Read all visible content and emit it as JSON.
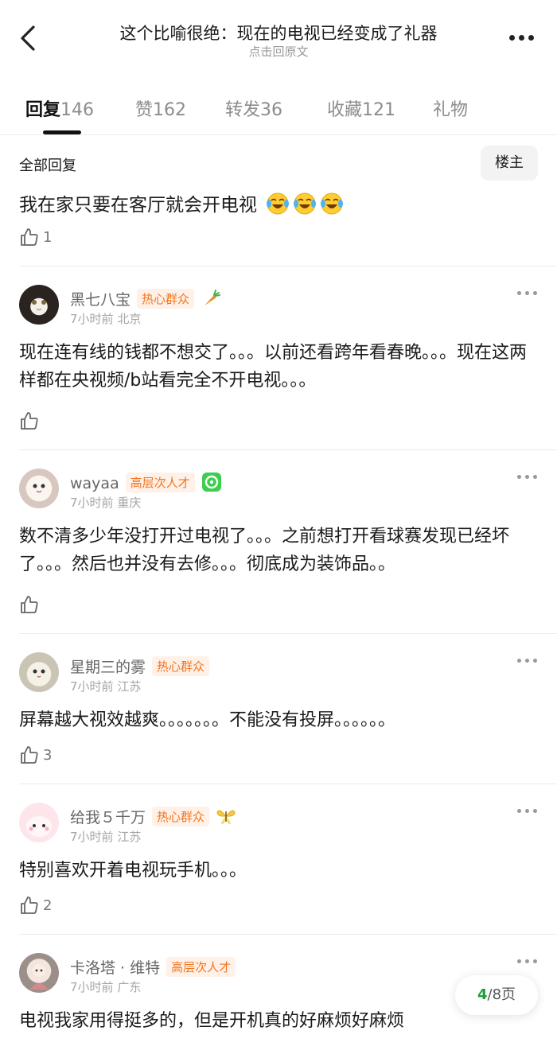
{
  "header": {
    "title": "这个比喻很绝：现在的电视已经变成了礼器",
    "subtitle": "点击回原文"
  },
  "tabs": [
    {
      "label": "回复",
      "count": "146"
    },
    {
      "label": "赞",
      "count": "162"
    },
    {
      "label": "转发",
      "count": "36"
    },
    {
      "label": "收藏",
      "count": "121"
    },
    {
      "label": "礼物",
      "count": ""
    }
  ],
  "post": {
    "section_label": "全部回复",
    "owner_button": "楼主",
    "text": "我在家只要在客厅就会开电视",
    "emoji_icons": [
      "laughing-tears-emoji",
      "laughing-tears-emoji",
      "laughing-tears-emoji"
    ],
    "likes": "1"
  },
  "comments": [
    {
      "user": "黑七八宝",
      "badge": "热心群众",
      "decoration": "carrot-icon",
      "time": "7小时前",
      "location": "北京",
      "text": "现在连有线的钱都不想交了。。。以前还看跨年看春晚。。。现在这两样都在央视频/b站看完全不开电视。。。",
      "likes": ""
    },
    {
      "user": "wayaa",
      "badge": "高层次人才",
      "decoration": "green-badge-icon",
      "time": "7小时前",
      "location": "重庆",
      "text": "数不清多少年没打开过电视了。。。之前想打开看球赛发现已经坏了。。。然后也并没有去修。。。彻底成为装饰品。。",
      "likes": ""
    },
    {
      "user": "星期三的雾",
      "badge": "热心群众",
      "decoration": "",
      "time": "7小时前",
      "location": "江苏",
      "text": "屏幕越大视效越爽。。。。。。。不能没有投屏。。。。。。",
      "likes": "3"
    },
    {
      "user": "给我５千万",
      "badge": "热心群众",
      "decoration": "butterfly-icon",
      "time": "7小时前",
      "location": "江苏",
      "text": "特别喜欢开着电视玩手机。。。",
      "likes": "2"
    },
    {
      "user": "卡洛塔 · 维特",
      "badge": "高层次人才",
      "decoration": "",
      "time": "7小时前",
      "location": "广东",
      "text": "电视我家用得挺多的，但是开机真的好麻烦好麻烦",
      "likes": ""
    }
  ],
  "pager": {
    "current": "4",
    "total": "/8页"
  },
  "colors": {
    "badge_text": "#f2751e",
    "badge_bg": "#fff1e8",
    "pager_current": "#1a9d3a"
  }
}
